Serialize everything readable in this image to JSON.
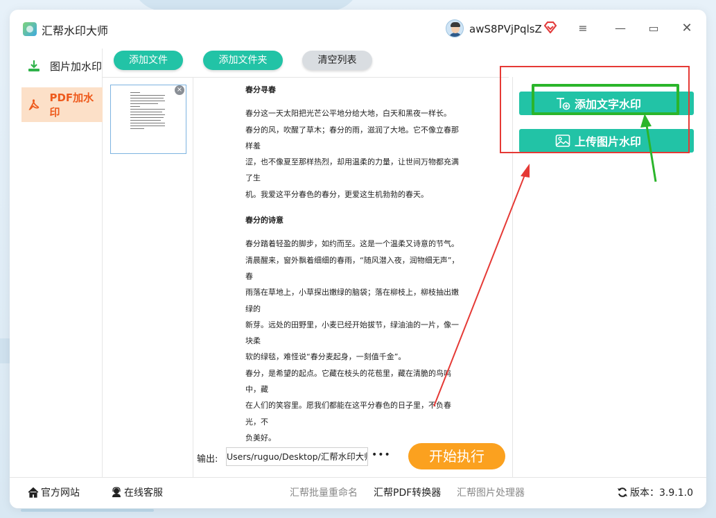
{
  "app": {
    "title": "汇帮水印大师",
    "username": "awS8PVjPqlsZ"
  },
  "window_controls": {
    "menu": "≡",
    "minimize": "—",
    "maximize": "▭",
    "close": "✕"
  },
  "sidebar": {
    "items": [
      {
        "label": "图片加水印",
        "icon": "download-tray-icon",
        "active": false
      },
      {
        "label": "PDF加水印",
        "icon": "pdf-icon",
        "active": true
      }
    ]
  },
  "toolbar": {
    "add_file": "添加文件",
    "add_folder": "添加文件夹",
    "clear_list": "清空列表"
  },
  "thumbnail": {
    "close": "×"
  },
  "preview": {
    "title1": "春分寻春",
    "para1": [
      "春分这一天太阳把光芒公平地分给大地，白天和黑夜一样长。",
      "春分的风，吹醒了草木；春分的雨，滋润了大地。它不像立春那样羞",
      "涩，也不像夏至那样热烈，却用温柔的力量，让世间万物都充满了生",
      "机。我爱这平分春色的春分，更爱这生机勃勃的春天。"
    ],
    "title2": "春分的诗意",
    "para2": [
      "春分踏着轻盈的脚步，如约而至。这是一个温柔又诗意的节气。",
      "清晨醒来，窗外飘着细细的春雨，“随风潜入夜，润物细无声”，春",
      "雨落在草地上，小草探出嫩绿的脑袋；落在柳枝上，柳枝抽出嫩绿的",
      "新芽。远处的田野里，小麦已经开始拔节，绿油油的一片，像一块柔",
      "软的绿毯，难怪说“春分麦起身，一刻值千金”。",
      "春分，是希望的起点。它藏在枝头的花苞里，藏在清脆的鸟鸣中，藏",
      "在人们的笑容里。愿我们都能在这平分春色的日子里，不负春光，不",
      "负美好。"
    ]
  },
  "watermark": {
    "add_text": "添加文字水印",
    "upload_image": "上传图片水印"
  },
  "output": {
    "label": "输出:",
    "path": "Users/ruguo/Desktop/汇帮水印大师",
    "more": "•••",
    "start": "开始执行"
  },
  "footer": {
    "official_site": "官方网站",
    "online_service": "在线客服",
    "batch_rename": "汇帮批量重命名",
    "pdf_converter": "汇帮PDF转换器",
    "image_processor": "汇帮图片处理器",
    "version": "版本：3.9.1.0"
  },
  "colors": {
    "teal": "#22c3a6",
    "orange": "#fba11f",
    "active_nav_bg": "#fce0c8",
    "active_nav_text": "#ee5a1c",
    "annotation_red": "#e53935",
    "annotation_green": "#2bb52b"
  }
}
